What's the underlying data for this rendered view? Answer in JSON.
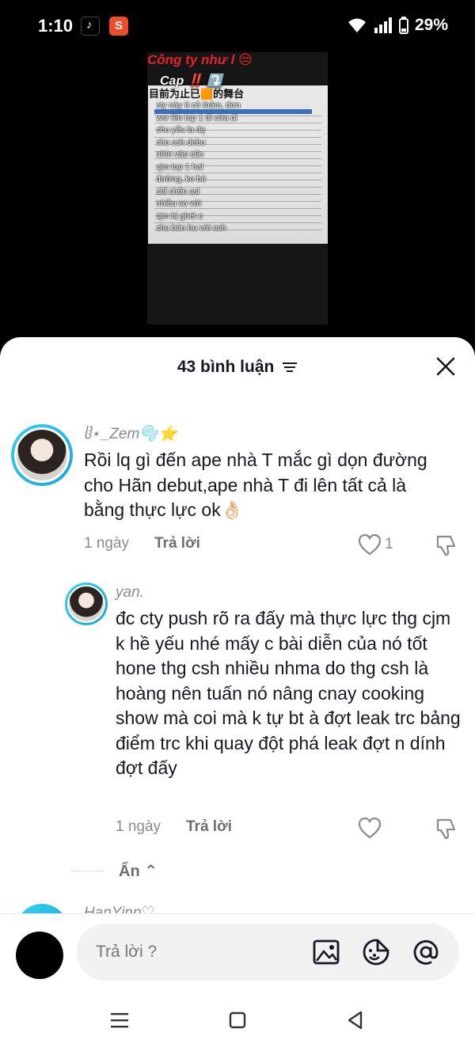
{
  "status_bar": {
    "time": "1:10",
    "battery": "29%"
  },
  "video": {
    "overlay_title": "Công ty như l 😒",
    "overlay_cap": "Cap ‼️ ⤵️",
    "overlay_cn": "目前为止已🟧的舞台",
    "overlay_lines": [
      "cty này ít cô thâm, đơn",
      "wsr lên top 1 đi cứa đi",
      "chu yếu la đẹ̣",
      "cho csh debu",
      "nhìn vào cũn",
      "cjm top 1 hal",
      "đường, ko bú",
      "chỉ chốn csl",
      "nhiều so với",
      "cjm bị ghét c",
      "chu bán hu với csh"
    ]
  },
  "comments_header": {
    "count_label": "43 bình luận"
  },
  "comments": [
    {
      "username": "ჱ⋆_Zem🫧⭐",
      "text": "Rồi lq gì đến ape nhà T mắc gì dọn đường cho Hãn debut,ape nhà T đi lên tất cả là bằng thực lực ok👌🏻",
      "time": "1 ngày",
      "reply_label": "Trả lời",
      "likes": "1"
    },
    {
      "username": "yan.",
      "text": "đc cty push rõ ra đấy mà thực lực thg cjm k hề yếu nhé mấy c bài diễn của nó tốt hone thg csh nhiều nhma do thg csh là hoàng nên tuấn nó nâng cnay cooking show mà coi mà k tự bt à đợt leak trc bảng điểm trc khi quay đột phá leak đợt n dính đợt đấy",
      "time": "1 ngày",
      "reply_label": "Trả lời"
    }
  ],
  "hide_replies": {
    "label": "Ẩn ⌃"
  },
  "next_comment": {
    "username": "HanYinn♡"
  },
  "input": {
    "placeholder": "Trả lời ?"
  },
  "colors": {
    "avatar_ring": "#1aa6d6",
    "text_primary": "#161823",
    "text_secondary": "#8a8b91",
    "overlay_red": "#e8222b"
  }
}
